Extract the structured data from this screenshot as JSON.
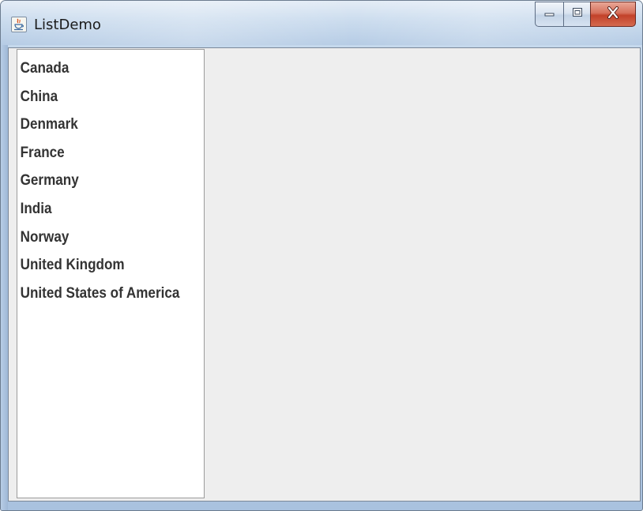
{
  "window": {
    "title": "ListDemo"
  },
  "icons": {
    "app": "java-cup-icon",
    "minimize": "minimize-icon",
    "maximize": "maximize-icon",
    "close": "close-icon"
  },
  "countries": {
    "items": [
      "Canada",
      "China",
      "Denmark",
      "France",
      "Germany",
      "India",
      "Norway",
      "United Kingdom",
      "United States of America"
    ]
  },
  "colors": {
    "close_button": "#c2412a",
    "panel_background": "#eeeeee",
    "list_background": "#ffffff",
    "list_text": "#333333"
  }
}
